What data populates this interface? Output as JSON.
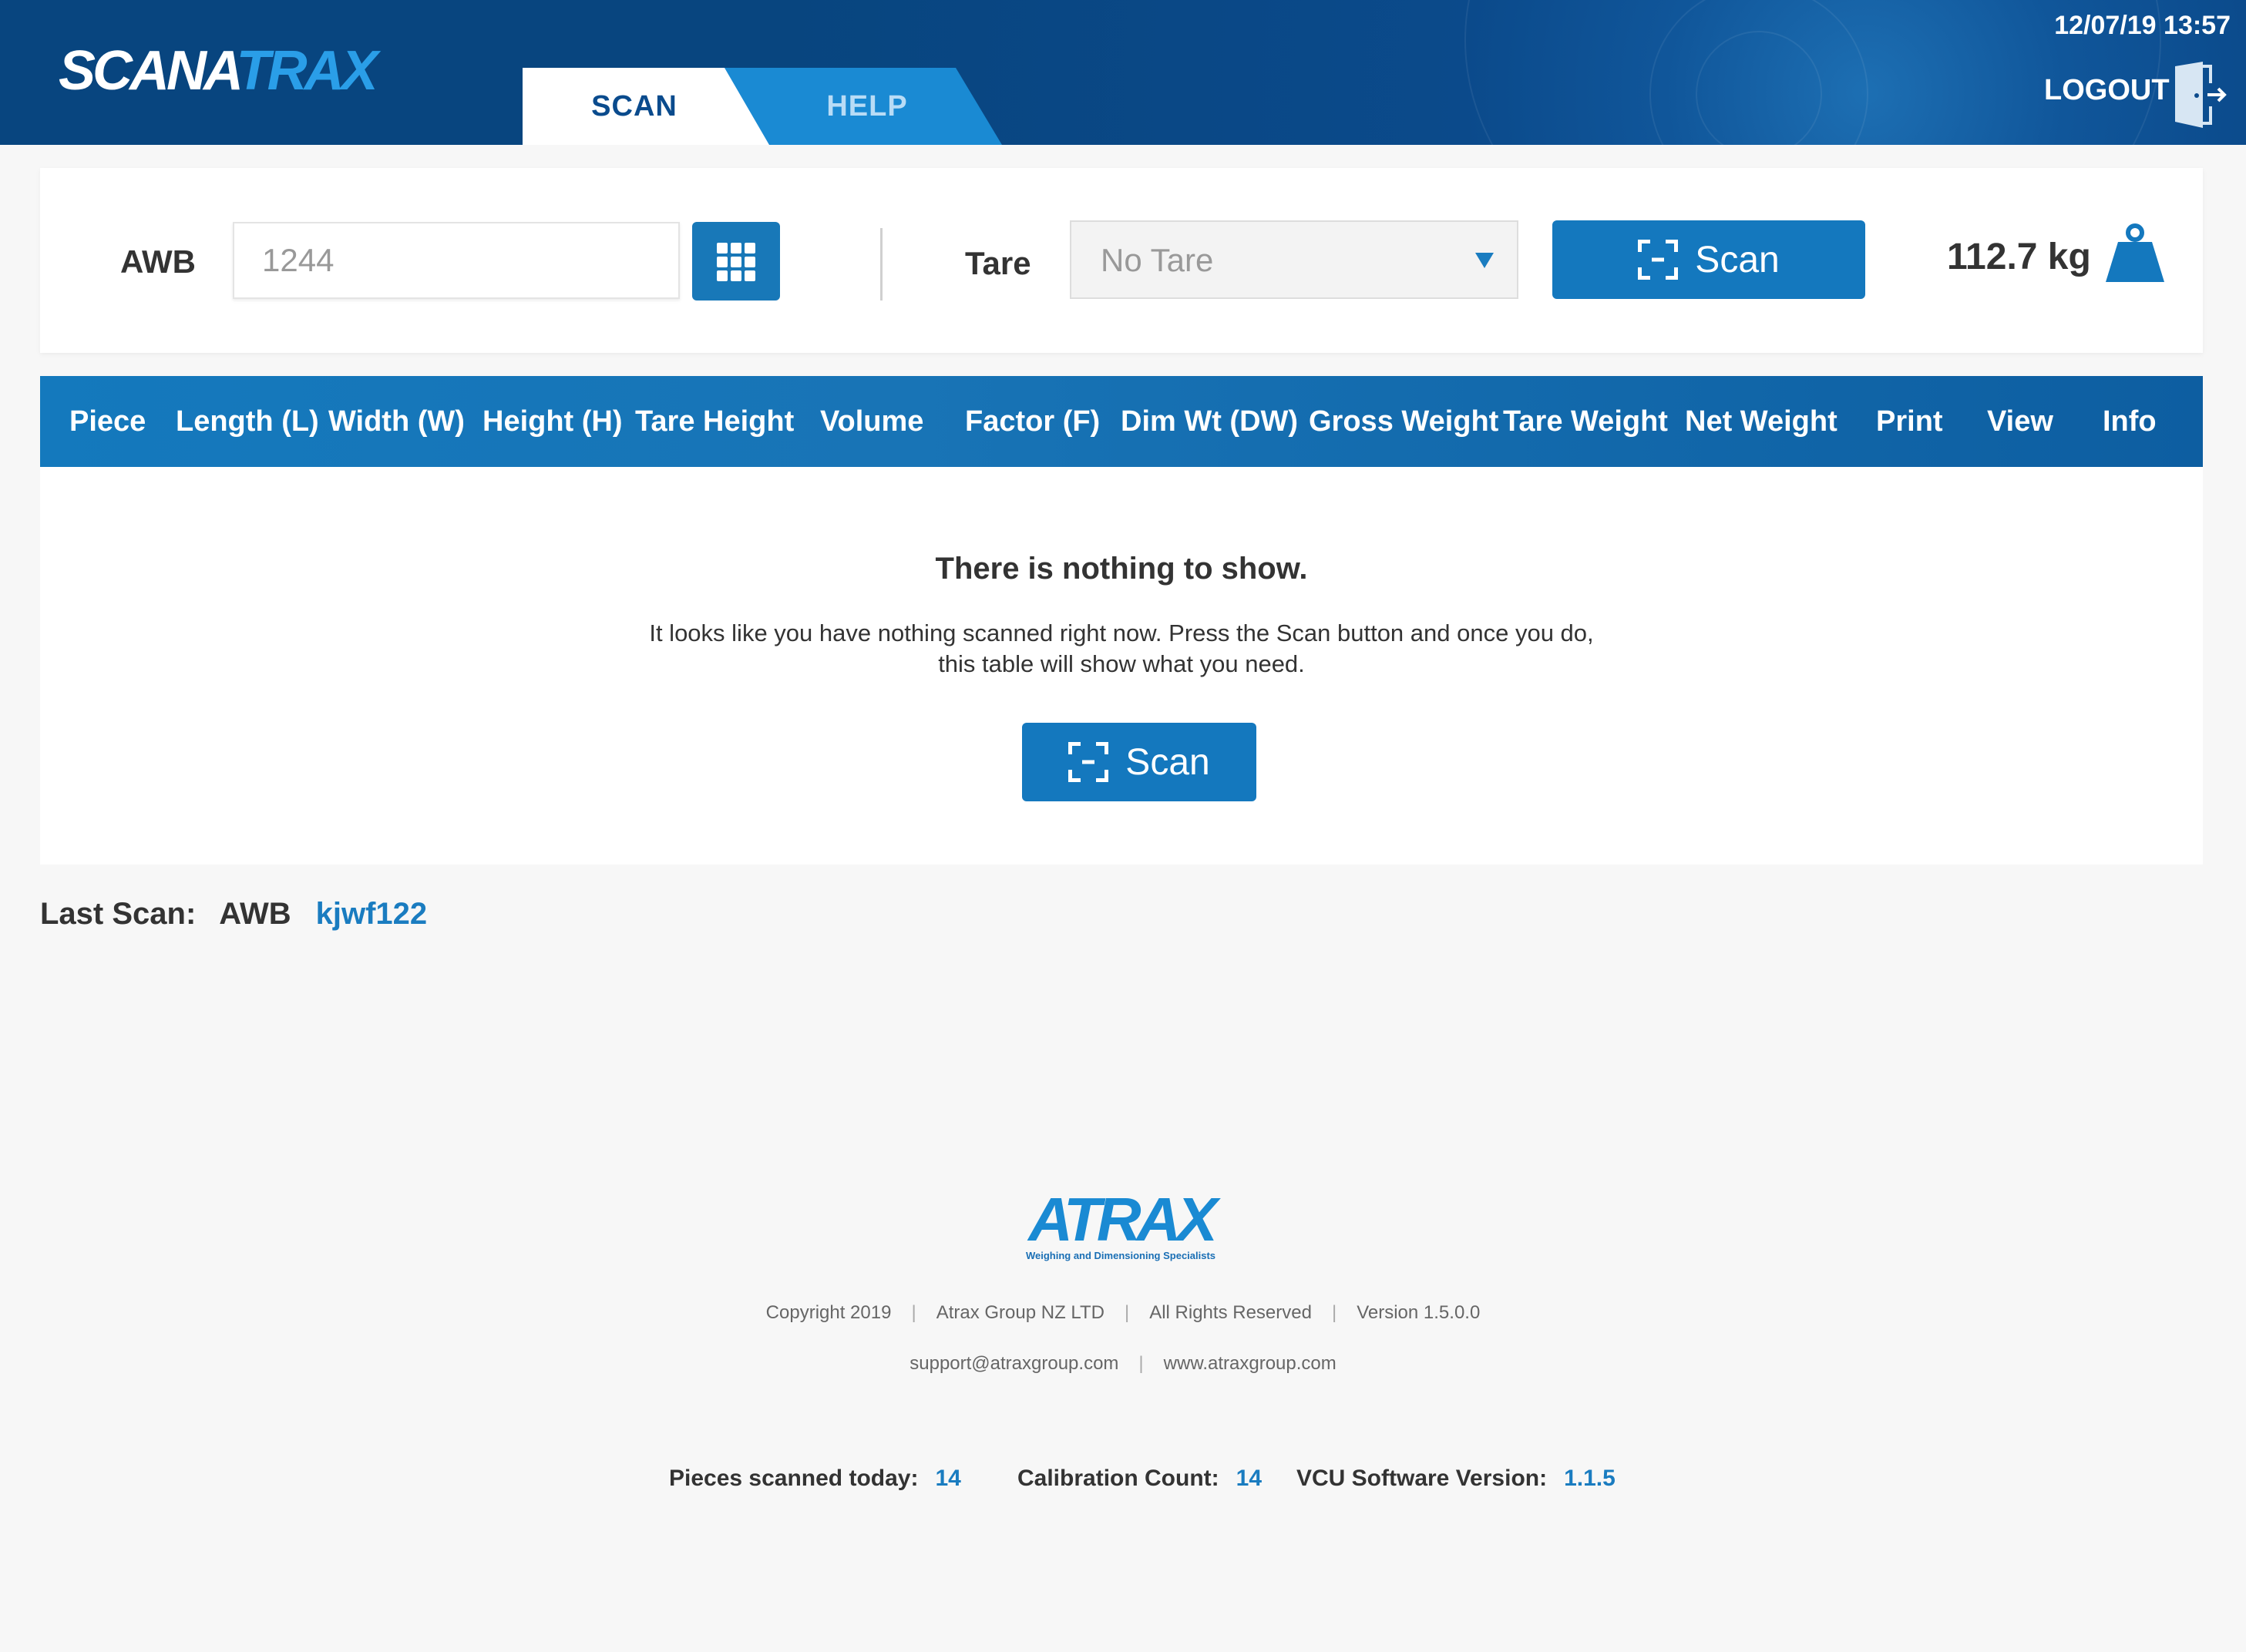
{
  "header": {
    "logo_white": "SCANA",
    "logo_blue": "TRAX",
    "datetime": "12/07/19 13:57",
    "logout_label": "LOGOUT",
    "tabs": [
      {
        "label": "SCAN",
        "active": true
      },
      {
        "label": "HELP",
        "active": false
      }
    ]
  },
  "scan_bar": {
    "awb_label": "AWB",
    "awb_value": "1244",
    "tare_label": "Tare",
    "tare_selected": "No Tare",
    "scan_label": "Scan",
    "weight": "112.7 kg"
  },
  "table": {
    "columns": [
      "Piece",
      "Length (L)",
      "Width (W)",
      "Height (H)",
      "Tare Height",
      "Volume",
      "Factor (F)",
      "Dim Wt (DW)",
      "Gross Weight",
      "Tare Weight",
      "Net Weight",
      "Print",
      "View",
      "Info"
    ],
    "empty_title": "There is nothing to show.",
    "empty_text_line1": "It looks like you have nothing scanned right now.  Press the Scan button and once you do,",
    "empty_text_line2": "this table will show what you need.",
    "scan_label": "Scan"
  },
  "last_scan": {
    "label": "Last Scan:",
    "type": "AWB",
    "value": "kjwf122"
  },
  "footer": {
    "logo_text": "ATRAX",
    "logo_tagline": "Weighing and Dimensioning Specialists",
    "copyright": "Copyright 2019",
    "company": "Atrax Group NZ LTD",
    "rights": "All Rights Reserved",
    "version": "Version 1.5.0.0",
    "email": "support@atraxgroup.com",
    "website": "www.atraxgroup.com",
    "pieces_label": "Pieces scanned today:",
    "pieces_value": "14",
    "calibration_label": "Calibration Count:",
    "calibration_value": "14",
    "vcu_label": "VCU Software Version:",
    "vcu_value": "1.1.5"
  },
  "colors": {
    "header_blue": "#0b4a8b",
    "accent_blue": "#1478be",
    "link_blue": "#1a7cc0"
  },
  "icons": {
    "keypad": "keypad-icon",
    "scan": "scan-frame-icon",
    "weight": "weight-icon",
    "logout": "logout-door-icon",
    "dropdown": "chevron-down-icon"
  }
}
